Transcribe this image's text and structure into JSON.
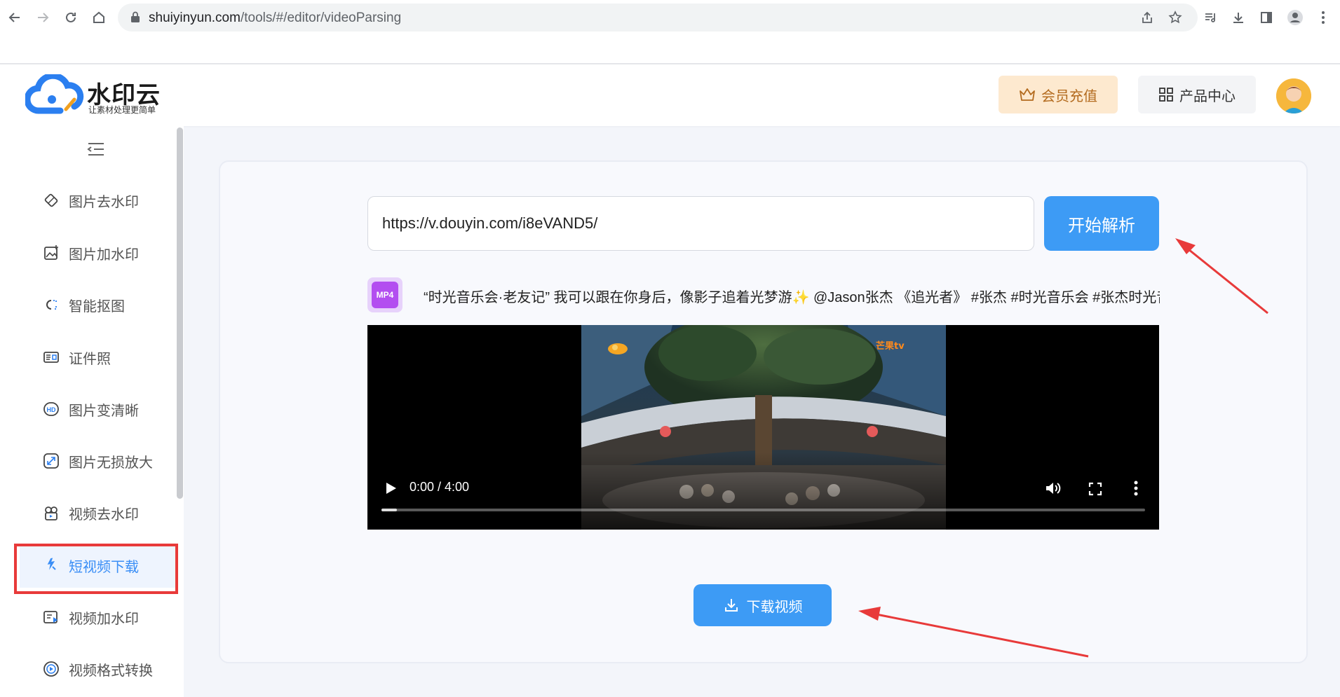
{
  "browser": {
    "url_host": "shuiyinyun.com",
    "url_path": "/tools/#/editor/videoParsing"
  },
  "header": {
    "logo_title": "水印云",
    "logo_slogan": "让素材处理更简单",
    "vip_label": "会员充值",
    "products_label": "产品中心"
  },
  "sidebar": {
    "items": [
      {
        "label": "图片去水印",
        "icon": "eraser-icon"
      },
      {
        "label": "图片加水印",
        "icon": "image-add-icon"
      },
      {
        "label": "智能抠图",
        "icon": "cutout-icon"
      },
      {
        "label": "证件照",
        "icon": "id-card-icon"
      },
      {
        "label": "图片变清晰",
        "icon": "hd-icon"
      },
      {
        "label": "图片无损放大",
        "icon": "enlarge-icon"
      },
      {
        "label": "视频去水印",
        "icon": "video-eraser-icon"
      },
      {
        "label": "短视频下载",
        "icon": "short-video-icon",
        "active": true
      },
      {
        "label": "视频加水印",
        "icon": "video-add-icon"
      },
      {
        "label": "视频格式转换",
        "icon": "convert-icon"
      }
    ]
  },
  "main": {
    "url_input_value": "https://v.douyin.com/i8eVAND5/",
    "parse_button": "开始解析",
    "format_badge": "MP4",
    "video_title": "“时光音乐会·老友记” 我可以跟在你身后，像影子追着光梦游✨ @Jason张杰 《追光者》 #张杰 #时光音乐会 #张杰时光音乐会",
    "video_time": "0:00 / 4:00",
    "video_progress": 0.02,
    "channel_logo": "芒果tv",
    "download_button": "下载视频"
  },
  "colors": {
    "accent": "#3d9bf5",
    "highlight_red": "#e83a3a",
    "vip_bg": "#fde9cf"
  }
}
